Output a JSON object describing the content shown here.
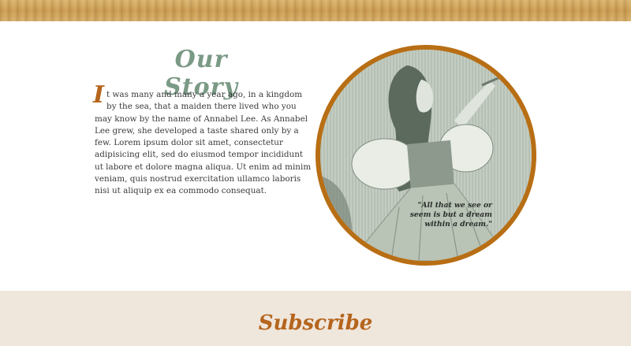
{
  "story": {
    "title": "Our Story",
    "dropcap": "I",
    "body": "t was many and many a year ago, in a kingdom by the sea, that a maiden there lived who you may know by the name of Annabel Lee. As Annabel Lee grew, she developed a taste shared only by a few. Lorem ipsum dolor sit amet, consectetur adipisicing elit, sed do eiusmod tempor incididunt ut labore et dolore magna aliqua. Ut enim ad minim veniam, quis nostrud exercitation ullamco laboris nisi ut aliquip ex ea commodo consequat.",
    "quote": "\"All that we see or seem is but a dream within a dream.\""
  },
  "subscribe": {
    "title": "Subscribe"
  },
  "colors": {
    "accent": "#b5651d",
    "title_green": "#7b9a86",
    "band": "#efe6dc"
  }
}
